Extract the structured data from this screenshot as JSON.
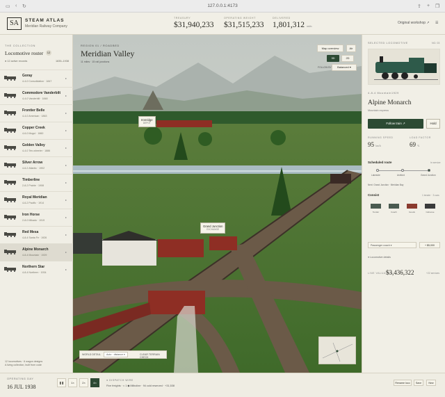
{
  "browser": {
    "url": "127.0.0.1:4173"
  },
  "header": {
    "logo": "SA",
    "brand": "STEAM ATLAS",
    "subtitle": "Meridian Railway Company",
    "stats": [
      {
        "label": "TREASURY",
        "value": "$31,940,233"
      },
      {
        "label": "OPERATING WEIGHT",
        "value": "$31,515,233"
      },
      {
        "label": "DELIVERED",
        "value": "1,801,312",
        "unit": "units"
      }
    ],
    "workshop_link": "Original workshop ↗"
  },
  "sidebar": {
    "caption": "THE COLLECTION",
    "title": "Locomotive roster",
    "count": "12",
    "active": "● 12 active records",
    "range": "1835–1938",
    "locomotives": [
      {
        "name": "Goray",
        "sub": "4-4-0 Consolidation · 1847"
      },
      {
        "name": "Commodore Vanderbilt",
        "sub": "4-4-0 Vanderbilt · 1848"
      },
      {
        "name": "Frontier Belle",
        "sub": "4-4-0 American · 1863"
      },
      {
        "name": "Copper Creek",
        "sub": "4-6-0 Mogul · 1860"
      },
      {
        "name": "Golden Valley",
        "sub": "4-4-0 Ten-wheeler · 1886"
      },
      {
        "name": "Silver Arrow",
        "sub": "4-6-2 Atlantic · 1902"
      },
      {
        "name": "Timberline",
        "sub": "2-8-2 Prairie · 1908"
      },
      {
        "name": "Royal Meridian",
        "sub": "4-6-2 Pacific · 1914"
      },
      {
        "name": "Iron Horse",
        "sub": "2-8-0 Mikado · 1919"
      },
      {
        "name": "Red Mesa",
        "sub": "4-8-4 Santa Fe · 1926"
      },
      {
        "name": "Alpine Monarch",
        "sub": "4-8-4 Mountain · 1929"
      },
      {
        "name": "Northern Star",
        "sub": "4-8-4 Northern · 1934"
      }
    ],
    "footer": [
      "12 locomotives · 6 wagon designs",
      "A living collection, built from code"
    ]
  },
  "scene": {
    "caption": "REGION 01 / ROADBED",
    "title": "Meridian Valley",
    "sub": "11 miles   ·   15 rail junctions",
    "map_overview": "Map overview",
    "air_btn": "Air",
    "view_3d": "3D",
    "view_2d": "2D",
    "follow_label": "FOLLOW BY",
    "follow_value": "Balanced",
    "labels": [
      {
        "name": "Ironridge",
        "sub": "DEPOT"
      },
      {
        "name": "Grand Junction",
        "sub": "EXCHANGE"
      }
    ],
    "bottom": {
      "caption": "WORLD DETAIL",
      "value": "Auto · distance",
      "button": "CLEAR TERRAIN CHECK"
    }
  },
  "detail": {
    "caption": "SELECTED LOCOMOTIVE",
    "id": "NO. 03",
    "wheel": "4-8-4 Mountain",
    "year": "1929",
    "name": "Alpine Monarch",
    "subtitle": "Mountain express",
    "follow": "Follow train ↗",
    "hold": "Hold",
    "metrics": [
      {
        "label": "RUNNING SPEED",
        "value": "95",
        "unit": "km/h"
      },
      {
        "label": "LOAD FACTOR",
        "value": "69",
        "unit": "%"
      }
    ],
    "route_title": "Scheduled route",
    "route_status": "In service",
    "stops": [
      "Lakeside",
      "Ashford",
      "Grand Junction"
    ],
    "route_note": "Next: Grand Junction · Meridian Bay",
    "consist_title": "Consist",
    "consist_info": "1 tender · 3 cars",
    "cars": [
      {
        "label": "Tender",
        "color": "#4a5a50"
      },
      {
        "label": "Coach",
        "color": "#4a5a50"
      },
      {
        "label": "Goods",
        "color": "#8a3a2e"
      },
      {
        "label": "Caboose",
        "color": "#3a3a3a"
      }
    ],
    "car_select": "Passenger coach",
    "add_car": "+ $5,000",
    "records_link": "● Locomotive details",
    "value_label": "LINE VALUATION",
    "value": "$3,436,322",
    "value_note": "+22 services"
  },
  "footer": {
    "label": "OPERATING DAY",
    "date": "16 JUL 1938",
    "speeds": [
      "❚❚",
      "1×",
      "2×",
      "4×"
    ],
    "dispatch_label": "● DISPATCH WIRE",
    "dispatch": "Five freights · ≈ 1 ◆ Milboline · 94 cold reserved · +31,538",
    "buttons": [
      "Rename loco",
      "Save",
      "New"
    ]
  }
}
